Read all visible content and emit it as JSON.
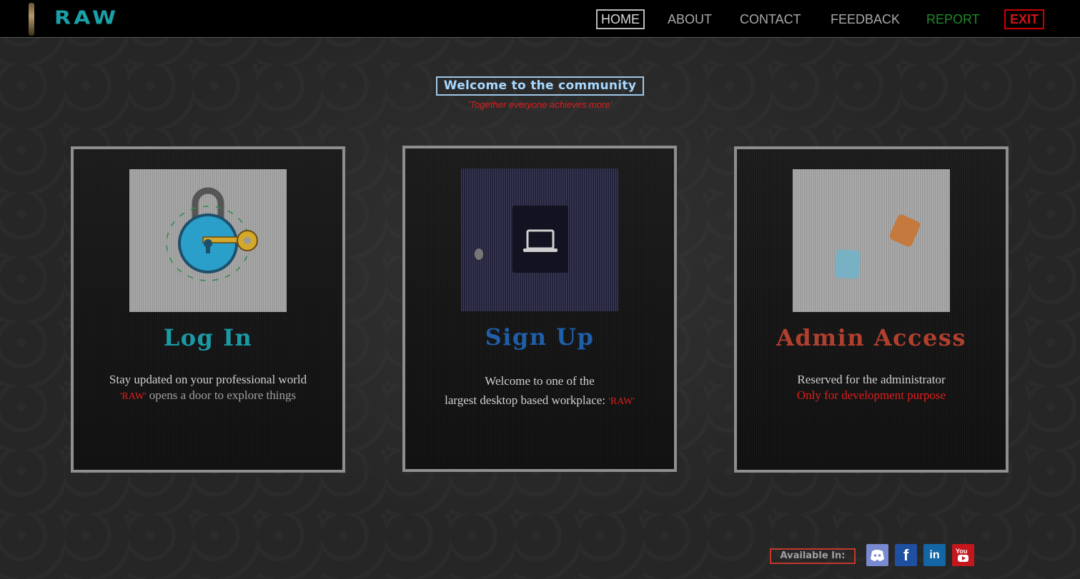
{
  "header": {
    "logo_text": "RAW",
    "nav": {
      "home": "HOME",
      "about": "ABOUT",
      "contact": "CONTACT",
      "feedback": "FEEDBACK",
      "report": "REPORT",
      "exit": "EXIT"
    }
  },
  "hero": {
    "welcome": "Welcome to the community",
    "tagline": "'Together everyone achieves more'"
  },
  "cards": {
    "login": {
      "title": "Log In",
      "line1": "Stay updated on your professional world",
      "line2_tag": "'RAW'",
      "line2_rest": " opens a door to explore things",
      "title_color": "#1a9aa5",
      "image_icon": "padlock-with-key-icon"
    },
    "signup": {
      "title": "Sign Up",
      "line1": "Welcome to one of the",
      "line2": "largest desktop based workplace: ",
      "line2_tag": "'RAW'",
      "title_color": "#1f5ea8",
      "image_icon": "laptop-door-icon"
    },
    "admin": {
      "title": "Admin Access",
      "line1": "Reserved for the administrator",
      "line2": "Only for development purpose",
      "title_color": "#b0402d",
      "image_icon": "floating-squares-icon"
    }
  },
  "footer": {
    "available_label": "Available In:",
    "social": [
      "discord-icon",
      "facebook-icon",
      "linkedin-icon",
      "youtube-icon"
    ],
    "social_text": {
      "facebook": "f",
      "linkedin": "in",
      "youtube": "You"
    }
  }
}
